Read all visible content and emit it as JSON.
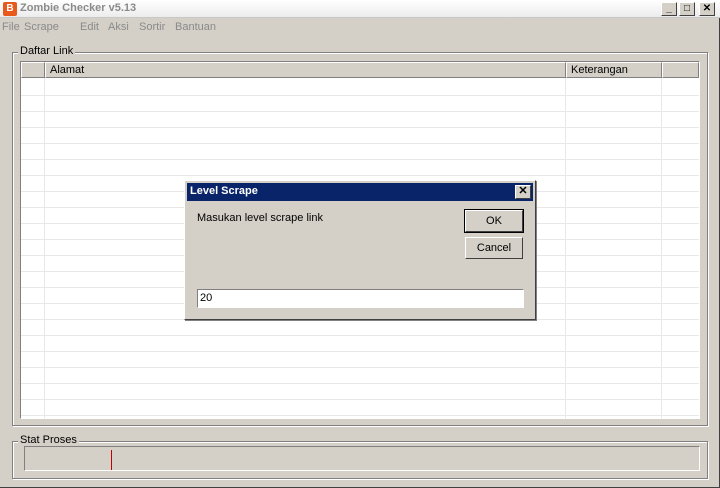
{
  "window": {
    "title": "Zombie Checker v5.13",
    "app_icon_glyph": "B",
    "min_glyph": "_",
    "max_glyph": "□",
    "close_glyph": "✕"
  },
  "menu": [
    "File",
    "Scrape",
    "Edit",
    "Aksi",
    "Sortir",
    "Bantuan"
  ],
  "links_group": {
    "label": "Daftar Link",
    "columns": [
      "",
      "Alamat",
      "Keterangan",
      ""
    ]
  },
  "status_group": {
    "label": "Stat Proses"
  },
  "dialog": {
    "title": "Level Scrape",
    "close_glyph": "✕",
    "prompt": "Masukan level scrape link",
    "ok_label": "OK",
    "cancel_label": "Cancel",
    "input_value": "20"
  },
  "colors": {
    "dialog_title_bg": "#0a246a",
    "app_icon": "#e85a1c",
    "progress_marker": "#c00000"
  }
}
